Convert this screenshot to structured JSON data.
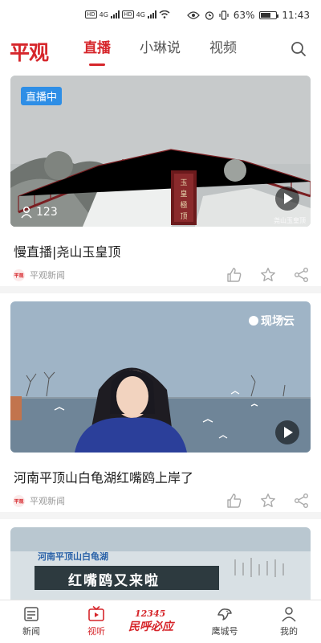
{
  "status_bar": {
    "tag1": "HD",
    "tag2": "HD",
    "net1": "4G",
    "net2": "4G",
    "battery": "63%",
    "time": "11:43"
  },
  "header": {
    "logo": "平观",
    "tabs": [
      {
        "label": "直播",
        "active": true
      },
      {
        "label": "小琳说",
        "active": false
      },
      {
        "label": "视频",
        "active": false
      }
    ],
    "search_icon": "search-icon"
  },
  "cards": [
    {
      "badge": "直播中",
      "viewers": "123",
      "watermark": "尧山玉皇顶",
      "title": "慢直播|尧山玉皇顶",
      "source": "平观新闻",
      "source_logo": "平观"
    },
    {
      "overlay_logo": "现场云",
      "title": "河南平顶山白龟湖红嘴鸥上岸了",
      "source": "平观新闻",
      "source_logo": "平观"
    },
    {
      "caption_small": "河南平顶山白龟湖",
      "caption_big": "红嘴鸥又来啦"
    }
  ],
  "bottom_nav": {
    "items": [
      {
        "label": "新闻",
        "icon": "news-icon"
      },
      {
        "label": "视听",
        "icon": "tv-icon",
        "active": true
      },
      {
        "label": "鹰城号",
        "icon": "eagle-icon"
      },
      {
        "label": "我的",
        "icon": "profile-icon"
      }
    ],
    "hotline_number": "12345",
    "hotline_text": "民呼必应"
  },
  "colors": {
    "accent": "#d6262b",
    "badge_blue": "#2e8ee6"
  }
}
